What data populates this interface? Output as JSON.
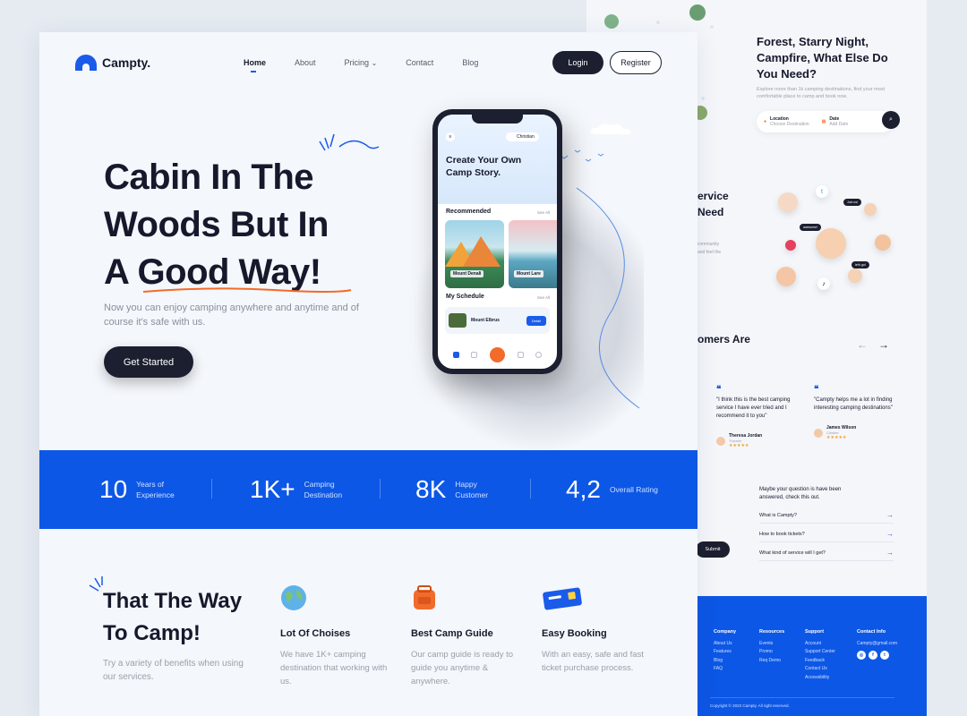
{
  "front": {
    "brand": "Campty.",
    "nav": {
      "links": [
        "Home",
        "About",
        "Pricing",
        "Contact",
        "Blog"
      ],
      "pricing_caret": "⌄",
      "login": "Login",
      "register": "Register"
    },
    "hero": {
      "title_line1": "Cabin In The",
      "title_line2": "Woods But In",
      "title_line3": "A Good Way!",
      "subtitle": "Now you can enjoy camping anywhere and anytime and of course it's safe with us.",
      "cta": "Get Started"
    },
    "phone": {
      "user": "Christian",
      "headline": "Create Your Own Camp Story.",
      "recommended": "Recommended",
      "see_all": "See All",
      "cards": [
        {
          "name": "Mount Denali"
        },
        {
          "name": "Mount Lare"
        }
      ],
      "my_schedule": "My Schedule",
      "schedule_item": "Mount Elbrus",
      "schedule_btn": "Detail"
    },
    "stats": [
      {
        "value": "10",
        "label": "Years of Experience"
      },
      {
        "value": "1K+",
        "label": "Camping Destination"
      },
      {
        "value": "8K",
        "label": "Happy Customer"
      },
      {
        "value": "4,2",
        "label": "Overall Rating"
      }
    ],
    "features_section": {
      "title_line1": "That The Way",
      "title_line2": "To Camp!",
      "subtitle": "Try a variety of benefits when using our services.",
      "items": [
        {
          "icon": "globe-icon",
          "title": "Lot Of Choises",
          "desc": "We have 1K+ camping destination that working with us."
        },
        {
          "icon": "backpack-icon",
          "title": "Best Camp Guide",
          "desc": "Our camp guide is ready to guide you anytime & anywhere."
        },
        {
          "icon": "ticket-icon",
          "title": "Easy Booking",
          "desc": "With an easy, safe and fast ticket purchase process."
        }
      ]
    }
  },
  "back": {
    "hero_title": "Forest, Starry Night, Campfire, What Else Do You Need?",
    "hero_sub": "Explore more than 1k camping destinations, find your most comfortable place to camp and book now.",
    "search": {
      "location_label": "Location",
      "location_placeholder": "Choose Destination",
      "date_label": "Date",
      "date_placeholder": "Add Date"
    },
    "service_fragment_1": "ervice",
    "service_fragment_2": "Need",
    "service_small_1": "community",
    "service_small_2": "and feel the",
    "bubbles": [
      "Join us!",
      "awesome!",
      "let's go!"
    ],
    "customers_fragment": "omers Are",
    "reviews": [
      {
        "text": "\"I think this is the best camping service I have ever tried and I recommend it to you\"",
        "name": "Theresa Jordan",
        "role": "Traveler",
        "stars": "★★★★★"
      },
      {
        "text": "\"Campty helps me a lot in finding interesting camping destinations\"",
        "name": "James Wilson",
        "role": "Climber",
        "stars": "★★★★★"
      }
    ],
    "faq": {
      "heading": "Maybe your question is have been answered, check this out.",
      "items": [
        "What is Campty?",
        "How to book tickets?",
        "What kind of service will I get?"
      ],
      "submit": "Submit"
    },
    "footer": {
      "columns": [
        {
          "title": "Company",
          "items": [
            "About Us",
            "Features",
            "Blog",
            "FAQ"
          ]
        },
        {
          "title": "Resources",
          "items": [
            "Events",
            "Promo",
            "Req Demo"
          ]
        },
        {
          "title": "Support",
          "items": [
            "Account",
            "Support Center",
            "Feedback",
            "Contact Us",
            "Accessibility"
          ]
        },
        {
          "title": "Contact Info",
          "items": [
            "Campty@gmail.com"
          ]
        }
      ],
      "copyright": "Copyright © 2022 Campty. All right reserved."
    }
  },
  "colors": {
    "primary_blue": "#0d57e6",
    "dark": "#1b1f2f",
    "accent_orange": "#f26b2a"
  }
}
